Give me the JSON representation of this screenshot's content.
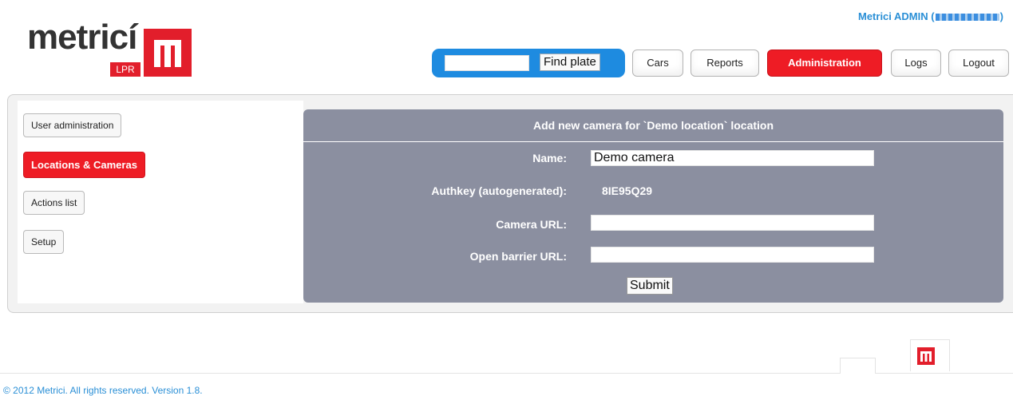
{
  "brand": {
    "name": "metricí",
    "badge": "LPR"
  },
  "header": {
    "user_prefix": "Metrici ADMIN (",
    "user_suffix": ")",
    "search": {
      "value": "",
      "button": "Find plate"
    },
    "nav": [
      "Cars",
      "Reports",
      "Administration",
      "Logs",
      "Logout"
    ],
    "active_nav": "Administration"
  },
  "sidebar": {
    "items": [
      "User administration",
      "Locations & Cameras",
      "Actions list",
      "Setup"
    ],
    "active": "Locations & Cameras"
  },
  "form": {
    "title": "Add new camera for `Demo location` location",
    "name_label": "Name:",
    "name_value": "Demo camera",
    "authkey_label": "Authkey (autogenerated):",
    "authkey_value": "8IE95Q29",
    "camera_url_label": "Camera URL:",
    "camera_url_value": "",
    "barrier_url_label": "Open barrier URL:",
    "barrier_url_value": "",
    "submit": "Submit"
  },
  "footer": {
    "copyright": "© 2012 Metrici. All rights reserved. Version 1.8."
  },
  "colors": {
    "accent_red": "#ee1c25",
    "link_blue": "#2a8fd6",
    "search_blue": "#1e8be0",
    "panel_gray": "#8b8fa0"
  },
  "icons": [
    "metrici-logo-icon",
    "metrici-footer-logo-icon"
  ]
}
